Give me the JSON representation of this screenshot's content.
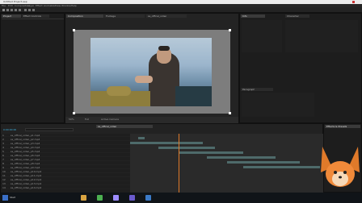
{
  "window": {
    "title": "Untitled Project.aep"
  },
  "menu": {
    "items": [
      "File",
      "Edit",
      "Composition",
      "Layer",
      "Effect",
      "Animation",
      "View",
      "Window",
      "Help"
    ]
  },
  "panels": {
    "project_tab": "Project",
    "effect_controls_tab": "Effect Controls",
    "composition_tab": "Composition",
    "footage_tab": "Footage",
    "composition_name": "ss_offical_video",
    "info_tab": "Info",
    "effects_tab": "Effects & Presets",
    "paragraph_tab": "Paragraph",
    "character_tab": "Character"
  },
  "preview": {
    "zoom": "50%",
    "view": "Full",
    "camera": "Active Camera"
  },
  "timeline": {
    "tab": "ss_offical_video",
    "timecode": "0:00:00:00",
    "search_placeholder": "",
    "layers": [
      {
        "num": "1",
        "name": "ss_offical_video_p1.mp4"
      },
      {
        "num": "2",
        "name": "ss_offical_video_p2.mp4"
      },
      {
        "num": "3",
        "name": "ss_offical_video_p3.mp4"
      },
      {
        "num": "4",
        "name": "ss_offical_video_p4.mp4"
      },
      {
        "num": "5",
        "name": "ss_offical_video_p5.mp4"
      },
      {
        "num": "6",
        "name": "ss_offical_video_p6.mp4"
      },
      {
        "num": "7",
        "name": "ss_offical_video_p7.mp4"
      },
      {
        "num": "8",
        "name": "ss_offical_video_p8.mp4"
      },
      {
        "num": "9",
        "name": "ss_offical_video_p9.mp4"
      },
      {
        "num": "10",
        "name": "ss_offical_video_p10.mp4"
      },
      {
        "num": "11",
        "name": "ss_offical_video_p11.mp4"
      },
      {
        "num": "12",
        "name": "ss_offical_video_p12.mp4"
      },
      {
        "num": "13",
        "name": "ss_offical_video_p13.mp4"
      },
      {
        "num": "14",
        "name": "ss_offical_video_p14.mp4"
      }
    ]
  },
  "taskbar": {
    "start_label": "Start"
  },
  "colors": {
    "ae_purple": "#9d8cff",
    "accent_orange": "#e07a2a",
    "sky": "#8aa9c4",
    "track_bar": "#4e6a6a"
  },
  "icons": [
    "windows-start-icon",
    "explorer-icon",
    "chrome-icon",
    "after-effects-icon",
    "premiere-icon",
    "photoshop-icon"
  ]
}
